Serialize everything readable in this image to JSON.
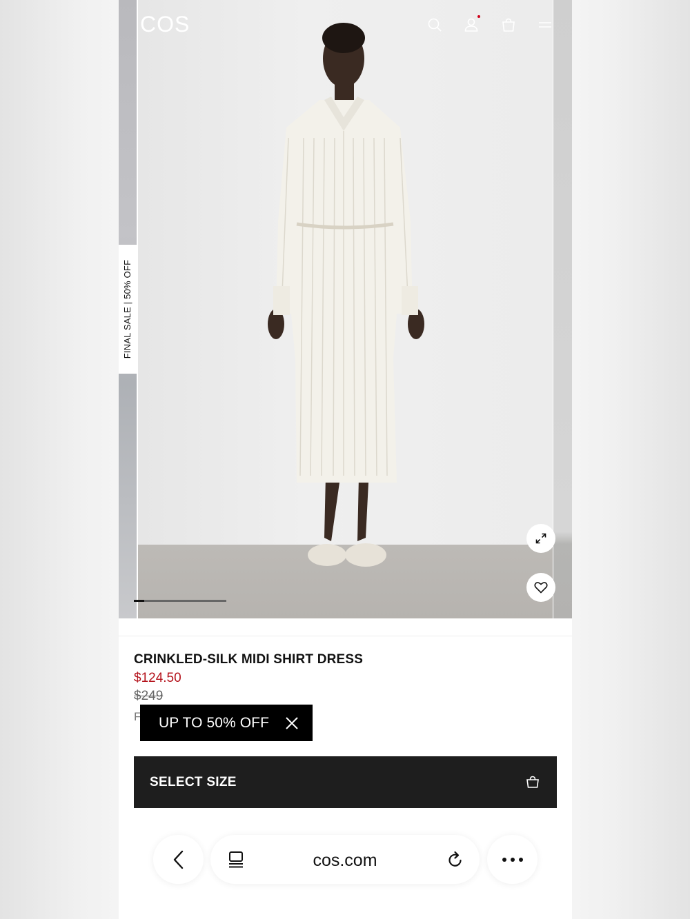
{
  "header": {
    "logo": "COS",
    "icons": [
      "search-icon",
      "account-icon",
      "bag-icon",
      "menu-icon"
    ]
  },
  "gallery": {
    "side_tab": "FINAL SALE | 50% OFF",
    "image_alt": "Model wearing crinkled-silk midi shirt dress",
    "current_slide_fraction": 0.11,
    "icons": [
      "expand-icon",
      "heart-icon"
    ]
  },
  "product": {
    "title": "CRINKLED-SILK MIDI SHIRT DRESS",
    "sale_price": "$124.50",
    "original_price": "$249",
    "partial_line": "F"
  },
  "promo": {
    "text": "UP TO 50% OFF"
  },
  "cta": {
    "label": "SELECT SIZE"
  },
  "browser": {
    "address": "cos.com"
  },
  "colors": {
    "sale_red": "#b4121b",
    "cta_bg": "#1e1e1e",
    "promo_bg": "#000000"
  }
}
